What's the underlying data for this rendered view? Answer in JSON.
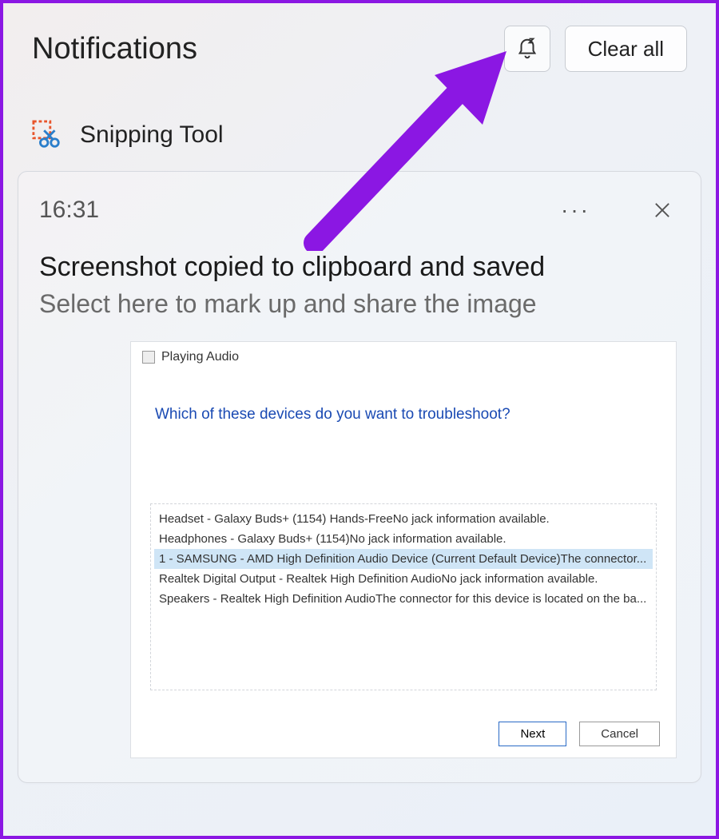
{
  "header": {
    "title": "Notifications",
    "clear_label": "Clear all"
  },
  "app": {
    "name": "Snipping Tool"
  },
  "notification": {
    "time": "16:31",
    "title": "Screenshot copied to clipboard and saved",
    "subtitle": "Select here to mark up and share the image",
    "more_label": "···"
  },
  "thumbnail": {
    "window_title": "Playing Audio",
    "question": "Which of these devices do you want to troubleshoot?",
    "devices": [
      "Headset - Galaxy Buds+ (1154) Hands-FreeNo jack information available.",
      "Headphones - Galaxy Buds+ (1154)No jack information available.",
      "1 - SAMSUNG - AMD High Definition Audio Device (Current Default Device)The connector...",
      "Realtek Digital Output - Realtek High Definition AudioNo jack information available.",
      "Speakers - Realtek High Definition AudioThe connector for this device is located on the ba..."
    ],
    "selected_index": 2,
    "next_label": "Next",
    "cancel_label": "Cancel"
  },
  "annotation": {
    "arrow_color": "#8b17e3"
  }
}
